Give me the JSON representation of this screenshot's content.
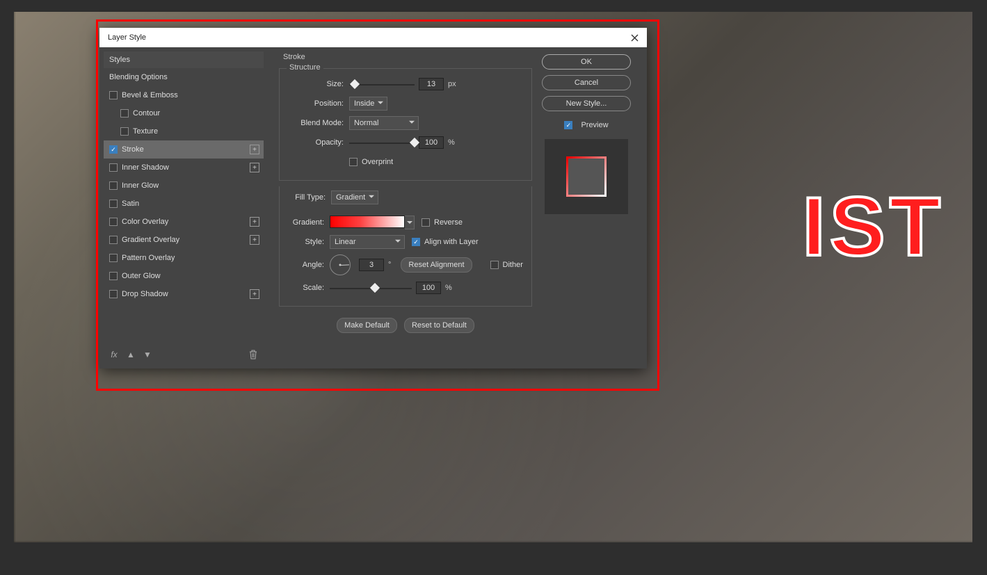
{
  "bg_text": "IST",
  "dialog": {
    "title": "Layer Style",
    "left": {
      "header": "Styles",
      "blending": "Blending Options",
      "items": [
        {
          "label": "Bevel & Emboss",
          "checked": false,
          "plus": false
        },
        {
          "label": "Contour",
          "checked": false,
          "plus": false,
          "sub": true
        },
        {
          "label": "Texture",
          "checked": false,
          "plus": false,
          "sub": true
        },
        {
          "label": "Stroke",
          "checked": true,
          "plus": true,
          "selected": true
        },
        {
          "label": "Inner Shadow",
          "checked": false,
          "plus": true
        },
        {
          "label": "Inner Glow",
          "checked": false,
          "plus": false
        },
        {
          "label": "Satin",
          "checked": false,
          "plus": false
        },
        {
          "label": "Color Overlay",
          "checked": false,
          "plus": true
        },
        {
          "label": "Gradient Overlay",
          "checked": false,
          "plus": true
        },
        {
          "label": "Pattern Overlay",
          "checked": false,
          "plus": false
        },
        {
          "label": "Outer Glow",
          "checked": false,
          "plus": false
        },
        {
          "label": "Drop Shadow",
          "checked": false,
          "plus": true
        }
      ]
    },
    "mid": {
      "panel_title": "Stroke",
      "structure_legend": "Structure",
      "size_label": "Size:",
      "size_value": "13",
      "size_unit": "px",
      "position_label": "Position:",
      "position_value": "Inside",
      "blendmode_label": "Blend Mode:",
      "blendmode_value": "Normal",
      "opacity_label": "Opacity:",
      "opacity_value": "100",
      "opacity_unit": "%",
      "overprint_label": "Overprint",
      "filltype_label": "Fill Type:",
      "filltype_value": "Gradient",
      "gradient_label": "Gradient:",
      "reverse_label": "Reverse",
      "style_label": "Style:",
      "style_value": "Linear",
      "align_label": "Align with Layer",
      "angle_label": "Angle:",
      "angle_value": "3",
      "angle_unit": "°",
      "reset_align": "Reset Alignment",
      "dither_label": "Dither",
      "scale_label": "Scale:",
      "scale_value": "100",
      "scale_unit": "%",
      "make_default": "Make Default",
      "reset_default": "Reset to Default"
    },
    "right": {
      "ok": "OK",
      "cancel": "Cancel",
      "newstyle": "New Style...",
      "preview": "Preview"
    }
  }
}
